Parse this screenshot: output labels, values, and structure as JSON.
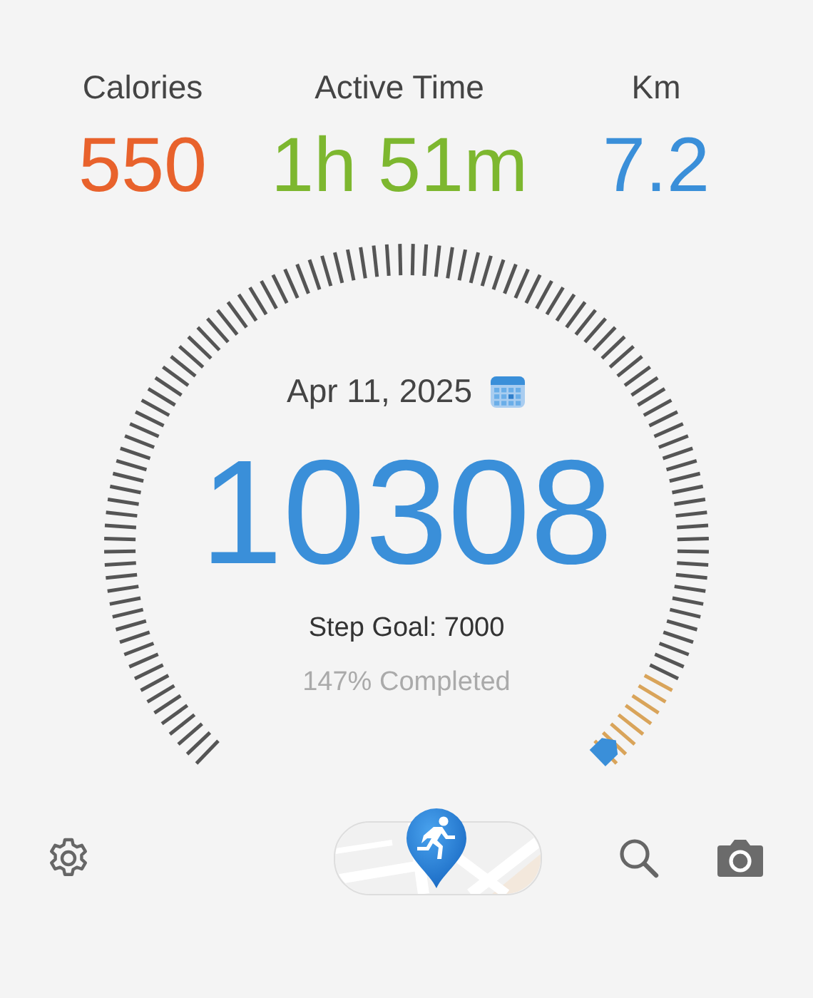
{
  "stats": [
    {
      "label": "Calories",
      "value": "550",
      "color": "#e8622c"
    },
    {
      "label": "Active Time",
      "value": "1h 51m",
      "color": "#7db72f"
    },
    {
      "label": "Km",
      "value": "7.2",
      "color": "#3a8fd9"
    }
  ],
  "gauge": {
    "date": "Apr 11, 2025",
    "steps": "10308",
    "goal": "Step Goal: 7000",
    "completed": "147% Completed"
  }
}
